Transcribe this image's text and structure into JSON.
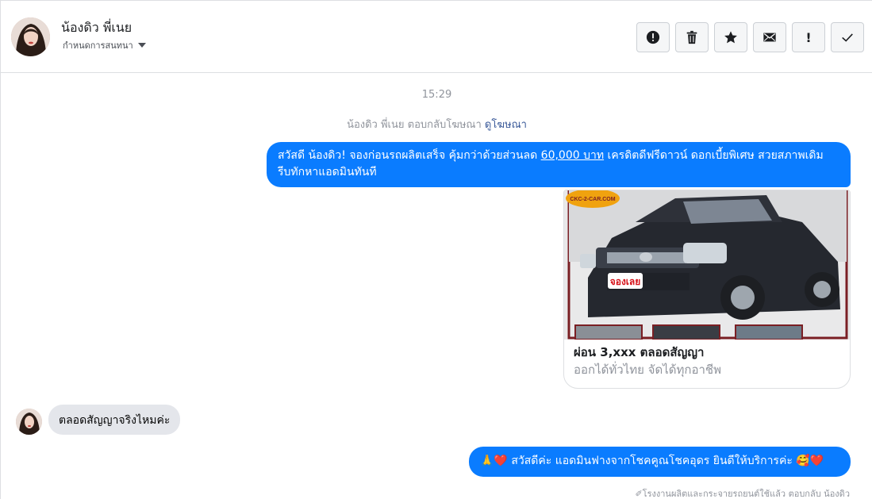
{
  "header": {
    "contact_name": "น้องดิว พี่เนย",
    "subtitle": "กำหนดการสนทนา"
  },
  "toolbar": {
    "buttons": [
      {
        "name": "report-button",
        "icon": "alert-circle-icon"
      },
      {
        "name": "delete-button",
        "icon": "trash-icon"
      },
      {
        "name": "star-button",
        "icon": "star-icon"
      },
      {
        "name": "mark-unread-button",
        "icon": "envelope-icon"
      },
      {
        "name": "important-button",
        "icon": "exclamation-icon",
        "label": "!"
      },
      {
        "name": "done-button",
        "icon": "checkmark-icon"
      }
    ]
  },
  "conversation": {
    "timestamp": "15:29",
    "reply_note_text": "น้องดิว พี่เนย ตอบกลับโฆษณา",
    "reply_note_link": "ดูโฆษณา",
    "outgoing_1": {
      "part1": "สวัสดี น้องดิว! จองก่อนรถผลิตเสร็จ คุ้มกว่าด้วยส่วนลด ",
      "highlight": "60,000 บาท",
      "part2": " เครดิตดีฟรีดาวน์ ดอกเบี้ยพิเศษ สวยสภาพเดิม รีบทักหาแอดมินทันที"
    },
    "ad_card": {
      "image_badge": "CKC-2-CAR.COM",
      "image_stamp": "จองเลย",
      "title": "ผ่อน 3,xxx ตลอดสัญญา",
      "description": "ออกได้ทั่วไทย จัดได้ทุกอาชีพ"
    },
    "incoming_1": "ตลอดสัญญาจริงไหมค่ะ",
    "outgoing_2": "🙏❤️ สวัสดีค่ะ แอดมินฟางจากโชคคูณโชคอุดร ยินดีให้บริการค่ะ 🥰❤️",
    "footer_note": "✐โรงงานผลิตและกระจายรถยนต์ใช้แล้ว ตอบกลับ น้องดิว"
  },
  "colors": {
    "accent": "#0a7cff",
    "incoming_bubble": "#e4e6eb",
    "link": "#385898"
  }
}
